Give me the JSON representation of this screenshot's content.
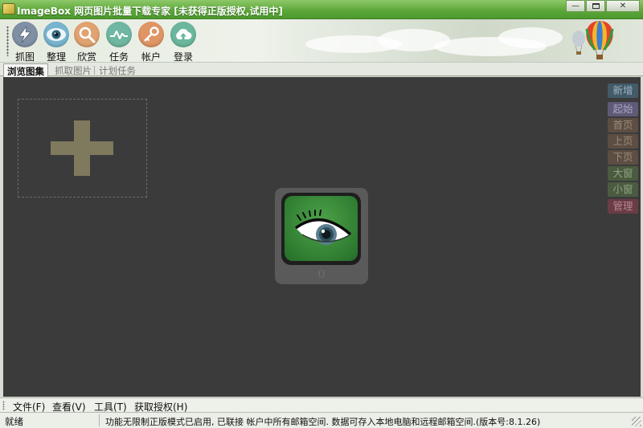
{
  "window": {
    "title": "ImageBox 网页图片批量下载专家 [未获得正版授权,试用中]",
    "minimize_icon": "minimize-icon",
    "maximize_icon": "maximize-icon",
    "close_icon": "close-icon"
  },
  "toolbar": {
    "items": [
      {
        "label": "抓图",
        "icon": "lightning-icon",
        "color": "#7f90a5"
      },
      {
        "label": "整理",
        "icon": "eye-icon",
        "color": "#79b4cf"
      },
      {
        "label": "欣赏",
        "icon": "magnifier-icon",
        "color": "#e0a270"
      },
      {
        "label": "任务",
        "icon": "pulse-icon",
        "color": "#6fb7a2"
      },
      {
        "label": "帐户",
        "icon": "key-icon",
        "color": "#e09565"
      },
      {
        "label": "登录",
        "icon": "cloud-upload-icon",
        "color": "#6bb79e"
      }
    ]
  },
  "tabs": [
    {
      "label": "浏览图集",
      "active": true
    },
    {
      "label": "抓取图片",
      "active": false
    },
    {
      "label": "计划任务",
      "active": false
    }
  ],
  "canvas": {
    "add_icon": "plus-icon",
    "center_icon": "eye-icon",
    "count": "0",
    "side_buttons": [
      {
        "label": "新增",
        "bg": "#435a69",
        "fg": "#9cb5c2"
      },
      {
        "label": "起始",
        "bg": "#5f5a76",
        "fg": "#a9a3c3"
      },
      {
        "label": "首页",
        "bg": "#5c4e43",
        "fg": "#9b8a7b"
      },
      {
        "label": "上页",
        "bg": "#5c4e43",
        "fg": "#9b8a7b"
      },
      {
        "label": "下页",
        "bg": "#5c4e43",
        "fg": "#9b8a7b"
      },
      {
        "label": "大窗",
        "bg": "#4b5b40",
        "fg": "#8fa380"
      },
      {
        "label": "小窗",
        "bg": "#4b5b40",
        "fg": "#8fa380"
      },
      {
        "label": "管理",
        "bg": "#6b3c45",
        "fg": "#b48891"
      }
    ]
  },
  "menubar": {
    "items": [
      "文件(F)",
      "查看(V)",
      "工具(T)",
      "获取授权(H)"
    ]
  },
  "statusbar": {
    "state": "就绪",
    "message": "功能无限制正版模式已启用, 已联接 帐户中所有邮箱空间. 数据可存入本地电脑和远程邮箱空间.(版本号:8.1.26)"
  },
  "colors": {
    "titlebar_green": "#5da83a",
    "canvas_bg": "#3b3b3b",
    "plus_color": "#7f7a5e"
  }
}
